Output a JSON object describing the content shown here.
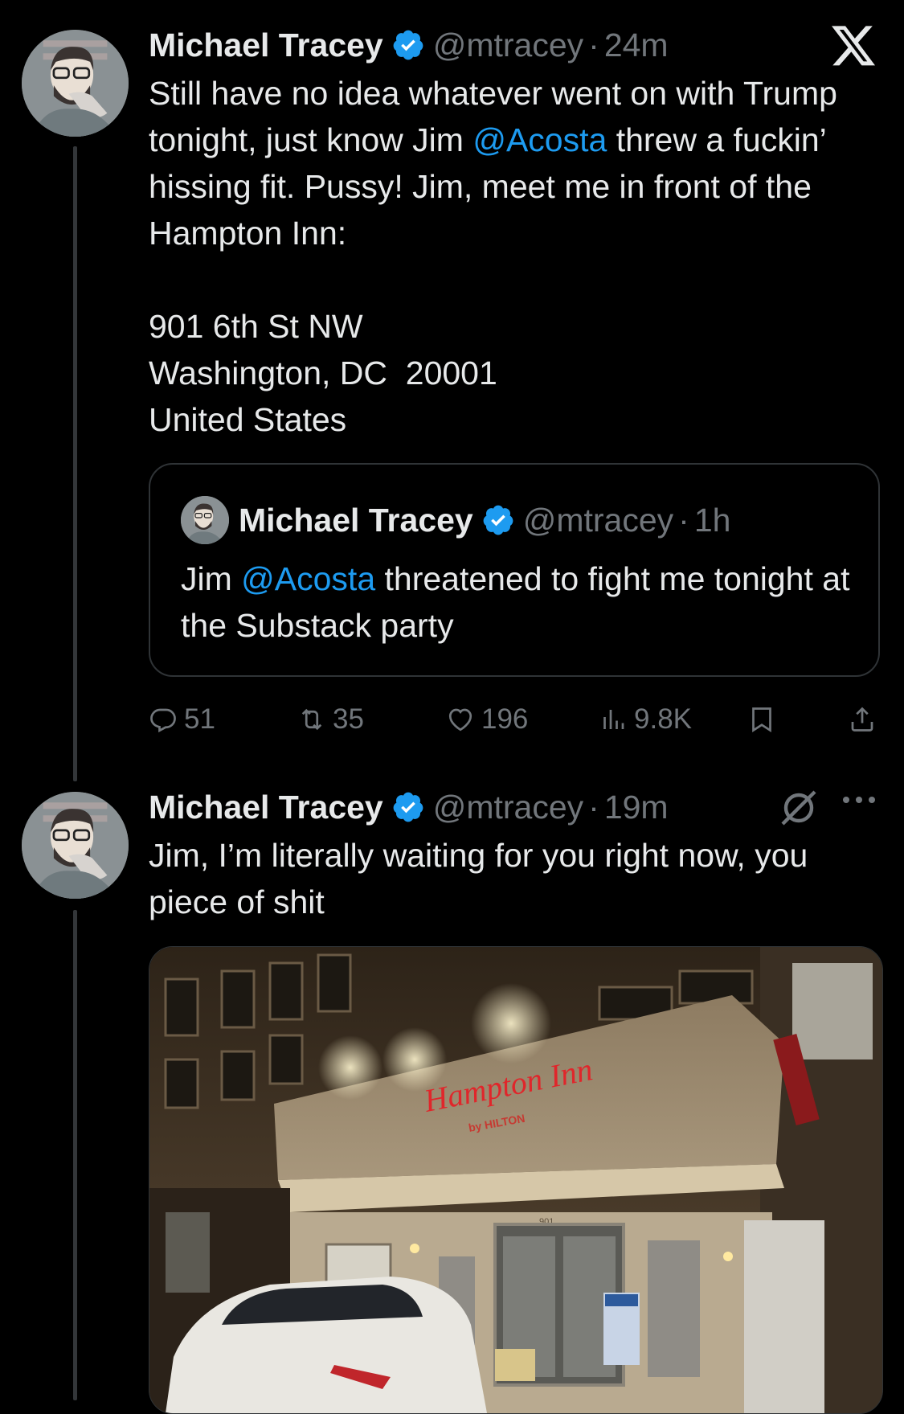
{
  "tweet1": {
    "author_name": "Michael Tracey",
    "handle": "@mtracey",
    "separator": "·",
    "time": "24m",
    "text_parts": [
      "Still have no idea whatever went on with Trump tonight, just know Jim ",
      "@Acosta",
      " threw a fuckin’ hissing fit. Pussy! Jim, meet me in front of the Hampton Inn:\n\n901 6th St NW\nWashington, DC  20001\nUnited States"
    ],
    "quote": {
      "author_name": "Michael Tracey",
      "handle": "@mtracey",
      "separator": "·",
      "time": "1h",
      "text_parts": [
        "Jim ",
        "@Acosta",
        " threatened to fight me tonight at the Substack party"
      ]
    },
    "actions": {
      "replies": "51",
      "reposts": "35",
      "likes": "196",
      "views": "9.8K"
    }
  },
  "tweet2": {
    "author_name": "Michael Tracey",
    "handle": "@mtracey",
    "separator": "·",
    "time": "19m",
    "text": "Jim, I’m literally waiting for you right now, you piece of shit",
    "photo": {
      "sign_text": "Hampton Inn",
      "sign_sub": "by HILTON",
      "address_number": "901"
    }
  },
  "icons": {
    "platform": "x-logo-icon",
    "verified": "verified-badge-icon",
    "reply": "reply-icon",
    "repost": "repost-icon",
    "like": "heart-icon",
    "views": "views-icon",
    "bookmark": "bookmark-icon",
    "share": "share-icon",
    "more": "more-icon",
    "muted": "muted-icon"
  },
  "colors": {
    "background": "#000000",
    "text": "#e7e9ea",
    "secondary": "#71767b",
    "link": "#1d9bf0",
    "border": "#2f3336",
    "sign_red": "#e0262b"
  }
}
